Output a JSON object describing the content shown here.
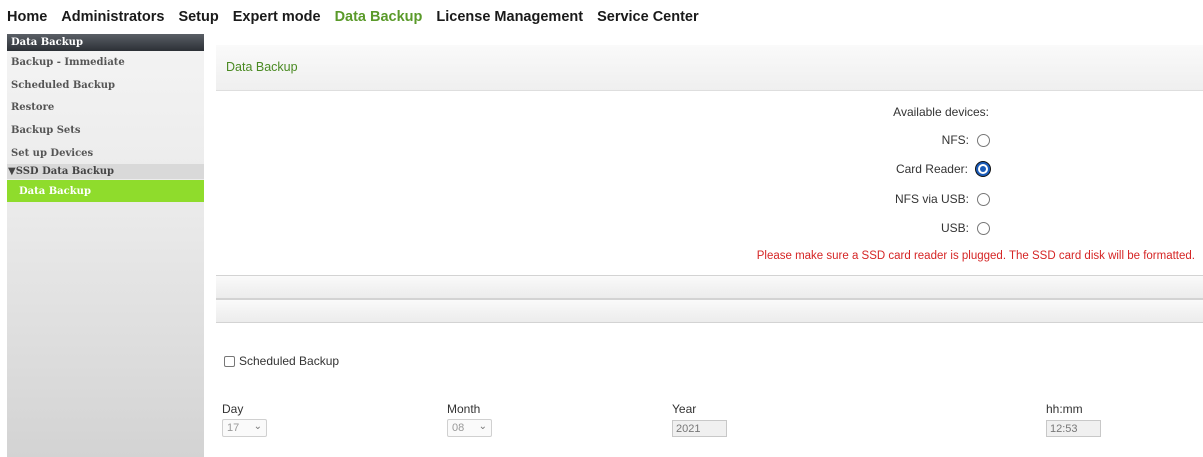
{
  "topnav": {
    "items": [
      "Home",
      "Administrators",
      "Setup",
      "Expert mode",
      "Data Backup",
      "License Management",
      "Service Center"
    ],
    "active_index": 4
  },
  "sidebar": {
    "title": "Data Backup",
    "items": [
      "Backup - Immediate",
      "Scheduled Backup",
      "Restore",
      "Backup Sets",
      "Set up Devices"
    ],
    "group": "▼SSD Data Backup",
    "active_item": "Data Backup"
  },
  "panel": {
    "title": "Data Backup"
  },
  "devices": {
    "heading": "Available devices:",
    "options": [
      {
        "label": "NFS:",
        "checked": false
      },
      {
        "label": "Card Reader:",
        "checked": true
      },
      {
        "label": "NFS via USB:",
        "checked": false
      },
      {
        "label": "USB:",
        "checked": false
      }
    ],
    "warning": "Please make sure a SSD card reader is plugged. The SSD card disk will be formatted."
  },
  "schedule": {
    "checkbox_label": "Scheduled Backup",
    "day_label": "Day",
    "day_value": "17",
    "month_label": "Month",
    "month_value": "08",
    "year_label": "Year",
    "year_value": "2021",
    "time_label": "hh:mm",
    "time_value": "12:53"
  },
  "colors": {
    "accent_green": "#5a9a2a",
    "active_sidebar": "#8fdc2c",
    "warning_red": "#d52525",
    "radio_selected": "#1a5bb8"
  }
}
